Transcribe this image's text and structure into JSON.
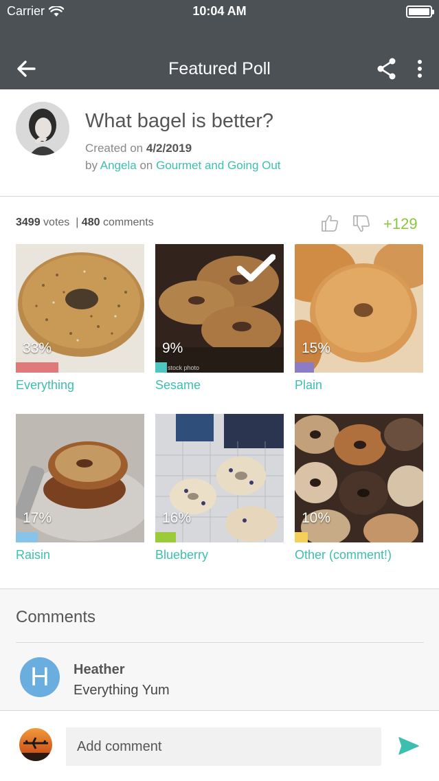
{
  "status": {
    "carrier": "Carrier",
    "time": "10:04 AM"
  },
  "nav": {
    "title": "Featured Poll"
  },
  "poll": {
    "question": "What bagel is better?",
    "created_prefix": "Created on",
    "created_date": "4/2/2019",
    "by_prefix": "by",
    "author": "Angela",
    "on_word": "on",
    "category": "Gourmet and Going Out"
  },
  "stats": {
    "votes": "3499",
    "votes_label": "votes",
    "sep": "|",
    "comments": "480",
    "comments_label": "comments",
    "score": "+129"
  },
  "options": [
    {
      "label": "Everything",
      "percent": "33%",
      "bar_value": 0.33,
      "color": "#e07a7a"
    },
    {
      "label": "Sesame",
      "percent": "9%",
      "bar_value": 0.09,
      "color": "#4ec7c0"
    },
    {
      "label": "Plain",
      "percent": "15%",
      "bar_value": 0.15,
      "color": "#8c7cc8"
    },
    {
      "label": "Raisin",
      "percent": "17%",
      "bar_value": 0.17,
      "color": "#86c4ea"
    },
    {
      "label": "Blueberry",
      "percent": "16%",
      "bar_value": 0.16,
      "color": "#9ccb3a"
    },
    {
      "label": "Other (comment!)",
      "percent": "10%",
      "bar_value": 0.1,
      "color": "#f4cf5a"
    }
  ],
  "comments": {
    "title": "Comments",
    "items": [
      {
        "initial": "H",
        "name": "Heather",
        "text": "Everything Yum"
      }
    ]
  },
  "composer": {
    "placeholder": "Add comment"
  },
  "watermark": "stock photo",
  "colors": {
    "header": "#4b5155",
    "accent": "#3dbfb0",
    "score": "#8bc53f"
  }
}
